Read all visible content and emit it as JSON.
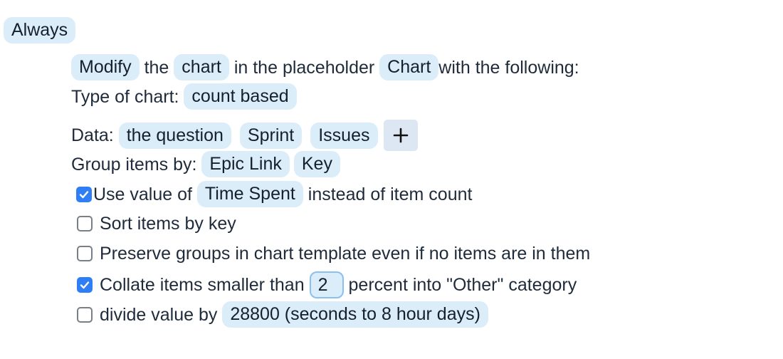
{
  "trigger": {
    "label": "Always"
  },
  "action": {
    "verb": "Modify",
    "text_the": " the ",
    "object": "chart",
    "text_placeholder": " in the placeholder ",
    "placeholder_name": "Chart",
    "text_following": "with the following:"
  },
  "chart_type": {
    "label": "Type of chart: ",
    "value": "count based"
  },
  "data": {
    "label": "Data: ",
    "items": [
      "the question",
      "Sprint",
      "Issues"
    ],
    "add_icon": "plus-icon"
  },
  "group_by": {
    "label": "Group items by: ",
    "items": [
      "Epic Link",
      "Key"
    ]
  },
  "options": {
    "use_value": {
      "checked": true,
      "text_before": "Use value of ",
      "field": "Time Spent",
      "text_after": " instead of item count"
    },
    "sort_by_key": {
      "checked": false,
      "text": "Sort items by key"
    },
    "preserve_groups": {
      "checked": false,
      "text": "Preserve groups in chart template even if no items are in them"
    },
    "collate": {
      "checked": true,
      "text_before": "Collate items smaller than ",
      "value": "2",
      "text_after": " percent into \"Other\" category"
    },
    "divide": {
      "checked": false,
      "text_before": "divide value by ",
      "value": "28800 (seconds to 8 hour days)"
    }
  },
  "colors": {
    "pill_bg": "#dcedfa",
    "checkbox_checked": "#2f7ef5",
    "text": "#1f2b3a"
  }
}
